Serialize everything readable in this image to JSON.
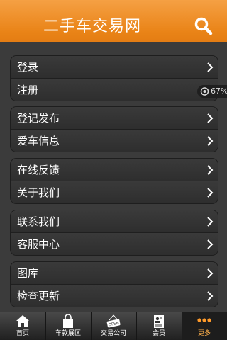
{
  "header": {
    "title": "二手车交易网",
    "search_icon": "search-icon"
  },
  "menu_groups": [
    {
      "items": [
        {
          "label": "登录"
        },
        {
          "label": "注册"
        }
      ]
    },
    {
      "items": [
        {
          "label": "登记发布"
        },
        {
          "label": "爱车信息"
        }
      ]
    },
    {
      "items": [
        {
          "label": "在线反馈"
        },
        {
          "label": "关于我们"
        }
      ]
    },
    {
      "items": [
        {
          "label": "联系我们"
        },
        {
          "label": "客服中心"
        }
      ]
    },
    {
      "items": [
        {
          "label": "图库"
        },
        {
          "label": "检查更新"
        }
      ]
    }
  ],
  "badge": {
    "percent": "67%"
  },
  "tabbar": {
    "tabs": [
      {
        "label": "首页",
        "icon": "home-icon"
      },
      {
        "label": "车款展区",
        "icon": "shopping-bag-icon"
      },
      {
        "label": "交易公司",
        "icon": "open-sign-icon"
      },
      {
        "label": "会员",
        "icon": "member-card-icon"
      },
      {
        "label": "更多",
        "icon": "more-dots-icon"
      }
    ],
    "active_index": 4
  },
  "colors": {
    "accent": "#e98316",
    "active_tab_label": "#ffb04a",
    "background": "#3a3a3a"
  }
}
